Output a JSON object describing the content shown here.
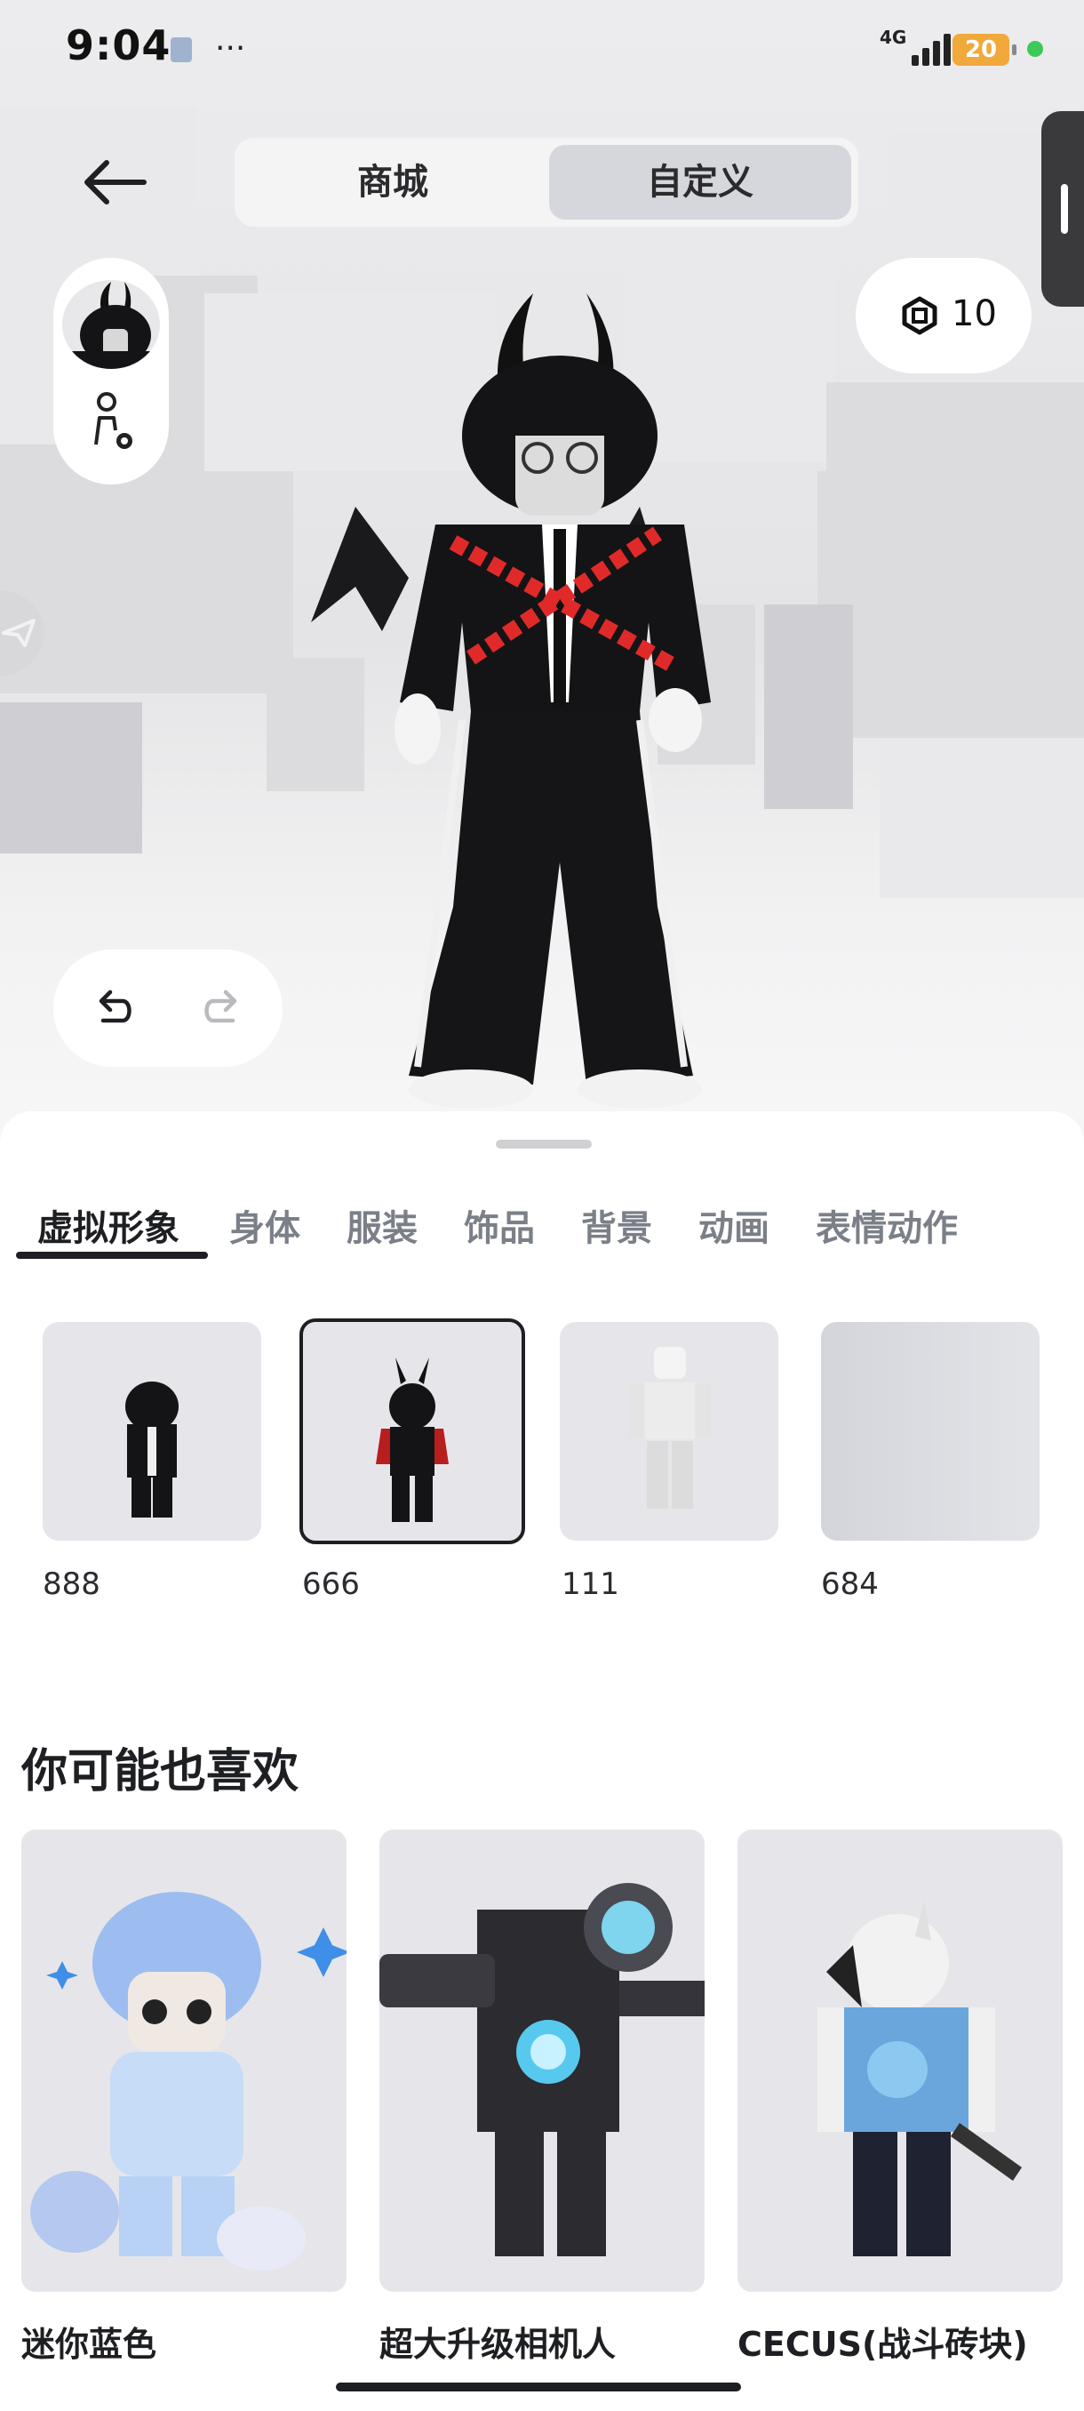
{
  "status_bar": {
    "time": "9:04",
    "more": "···",
    "network": "4G",
    "battery": "20",
    "battery_color": "#f2a93b"
  },
  "header": {
    "back_icon": "arrow-left-icon",
    "tabs": [
      {
        "label": "商城",
        "selected": false
      },
      {
        "label": "自定义",
        "selected": true
      }
    ]
  },
  "currency": {
    "icon": "robux-icon",
    "amount": "10"
  },
  "categories": [
    {
      "label": "虚拟形象",
      "selected": true
    },
    {
      "label": "身体",
      "selected": false
    },
    {
      "label": "服装",
      "selected": false
    },
    {
      "label": "饰品",
      "selected": false
    },
    {
      "label": "背景",
      "selected": false
    },
    {
      "label": "动画",
      "selected": false
    },
    {
      "label": "表情动作",
      "selected": false
    }
  ],
  "outfits": [
    {
      "name": "888",
      "selected": false
    },
    {
      "name": "666",
      "selected": true
    },
    {
      "name": "111",
      "selected": false
    },
    {
      "name": "684",
      "selected": false
    }
  ],
  "recommendations": {
    "title": "你可能也喜欢",
    "items": [
      {
        "name": "迷你蓝色"
      },
      {
        "name": "超大升级相机人"
      },
      {
        "name": "CECUS(战斗砖块)"
      }
    ]
  }
}
